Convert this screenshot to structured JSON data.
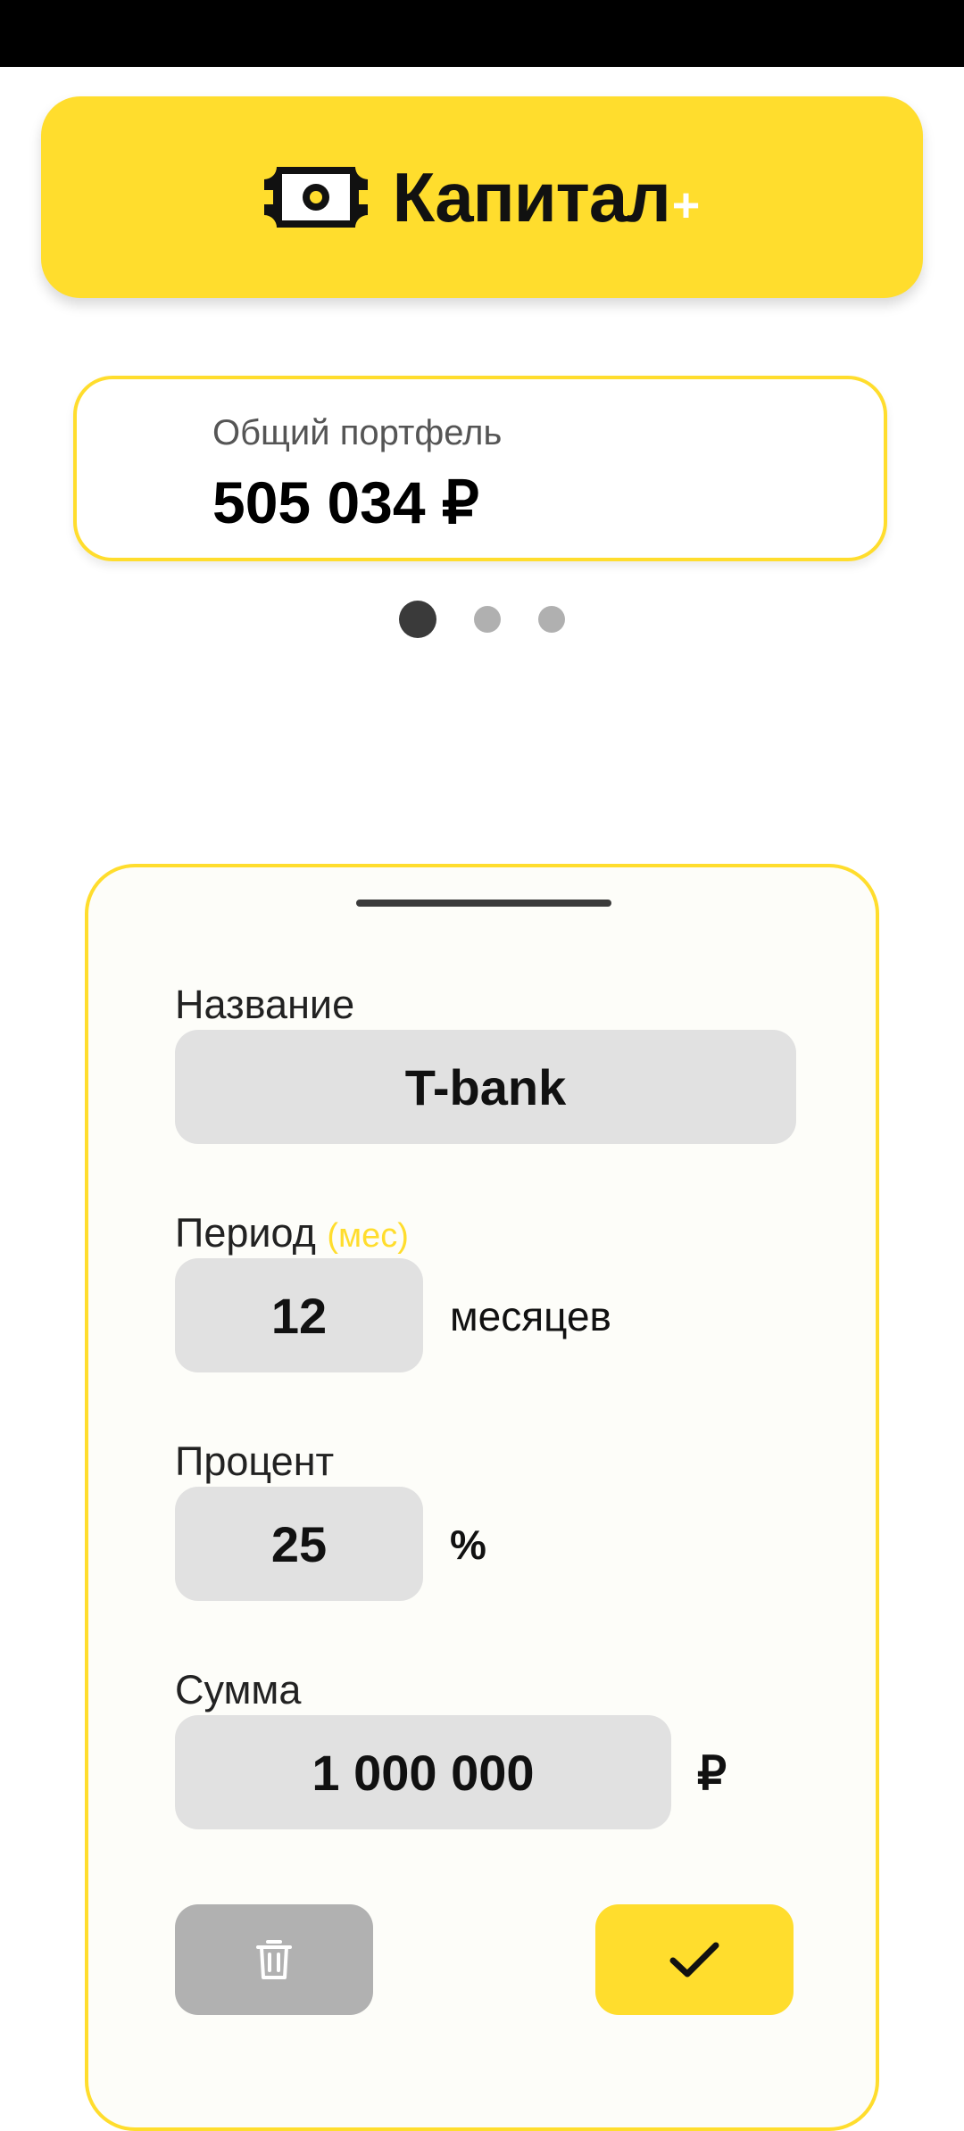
{
  "app": {
    "name": "Капитал",
    "plus": "+"
  },
  "portfolio": {
    "label": "Общий портфель",
    "value": "505 034 ₽"
  },
  "carousel": {
    "pages": 3,
    "active_index": 0
  },
  "form": {
    "name": {
      "label": "Название",
      "value": "T-bank"
    },
    "period": {
      "label": "Период",
      "hint": "(мес)",
      "value": "12",
      "unit": "месяцев"
    },
    "percent": {
      "label": "Процент",
      "value": "25",
      "unit": "%"
    },
    "sum": {
      "label": "Сумма",
      "value": "1 000 000",
      "unit": "₽"
    }
  },
  "buttons": {
    "delete_icon": "trash-icon",
    "confirm_icon": "check-icon"
  },
  "colors": {
    "brand_yellow": "#FFDD2D",
    "input_bg": "#E1E1E1",
    "delete_bg": "#B1B1B1"
  }
}
